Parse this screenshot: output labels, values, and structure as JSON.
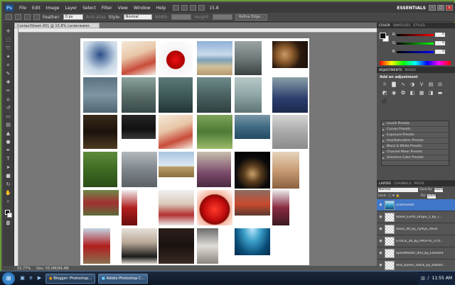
{
  "menubar": {
    "app_icon": "Ps",
    "items": [
      "File",
      "Edit",
      "Image",
      "Layer",
      "Select",
      "Filter",
      "View",
      "Window",
      "Help"
    ],
    "zoom": "15.8",
    "workspace": "ESSENTIALS",
    "window_controls": [
      "-",
      "□",
      "x"
    ]
  },
  "options": {
    "feather_label": "Feather:",
    "feather_value": "0 px",
    "antialias_label": "Anti-alias",
    "style_label": "Style:",
    "style_value": "Normal",
    "width_label": "Width:",
    "height_label": "Height:",
    "refine_label": "Refine Edge..."
  },
  "document": {
    "tab_title": "ContactSheet-001 @ 15.8% (underwater, RGB/8) *"
  },
  "status": {
    "zoom": "15.77%",
    "doc_info": "Doc: 55.0M/99.4M"
  },
  "color_panel": {
    "tabs": [
      "COLOR",
      "SWATCHES",
      "STYLES"
    ],
    "r_label": "R",
    "r_value": "0",
    "g_label": "G",
    "g_value": "0",
    "b_label": "B",
    "b_value": "0"
  },
  "adjustments": {
    "tabs": [
      "ADJUSTMENTS",
      "MASKS"
    ],
    "title": "Add an adjustment",
    "presets": [
      "Levels Presets",
      "Curves Presets",
      "Exposure Presets",
      "Hue/Saturation Presets",
      "Black & White Presets",
      "Channel Mixer Presets",
      "Selective Color Presets"
    ]
  },
  "layers": {
    "tabs": [
      "LAYERS",
      "CHANNELS",
      "PATHS"
    ],
    "blend_mode": "Normal",
    "opacity_label": "Opacity:",
    "opacity_value": "100%",
    "lock_label": "Lock:",
    "fill_label": "Fill:",
    "fill_value": "100%",
    "list": [
      {
        "name": "underwater",
        "selected": true
      },
      {
        "name": "Stone_Earth_Drape_5_by_T...",
        "selected": false
      },
      {
        "name": "stock_49_by_nyfsys_stock",
        "selected": false
      },
      {
        "name": "STOCK_30_by_PROFYE_STO...",
        "selected": false
      },
      {
        "name": "SpiritMaster_003_by_Elandira",
        "selected": false
      },
      {
        "name": "Red_Queen_Stock_by_adistor...",
        "selected": false
      }
    ]
  },
  "taskbar": {
    "tasks": [
      {
        "label": "Blogger: Photoshop...",
        "active": false
      },
      {
        "label": "Adobe Photoshop C...",
        "active": true
      }
    ],
    "clock": "11:55 AM"
  }
}
